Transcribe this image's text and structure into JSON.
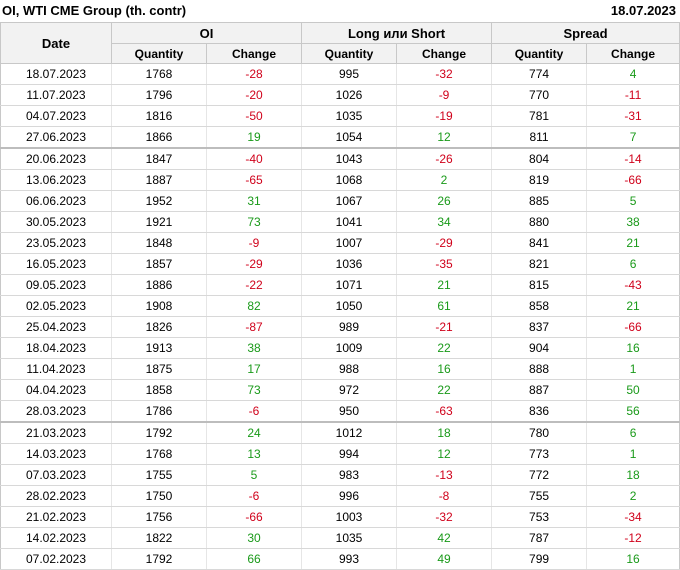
{
  "header": {
    "title": "OI, WTI CME Group (th. contr)",
    "date": "18.07.2023"
  },
  "table": {
    "date_header": "Date",
    "groups": [
      "OI",
      "Long или Short",
      "Spread"
    ],
    "sub_headers": [
      "Quantity",
      "Change",
      "Quantity",
      "Change",
      "Quantity",
      "Change"
    ],
    "rows": [
      [
        "18.07.2023",
        "1768",
        "-28",
        "995",
        "-32",
        "774",
        "4"
      ],
      [
        "11.07.2023",
        "1796",
        "-20",
        "1026",
        "-9",
        "770",
        "-11"
      ],
      [
        "04.07.2023",
        "1816",
        "-50",
        "1035",
        "-19",
        "781",
        "-31"
      ],
      [
        "27.06.2023",
        "1866",
        "19",
        "1054",
        "12",
        "811",
        "7"
      ],
      [
        "20.06.2023",
        "1847",
        "-40",
        "1043",
        "-26",
        "804",
        "-14"
      ],
      [
        "13.06.2023",
        "1887",
        "-65",
        "1068",
        "2",
        "819",
        "-66"
      ],
      [
        "06.06.2023",
        "1952",
        "31",
        "1067",
        "26",
        "885",
        "5"
      ],
      [
        "30.05.2023",
        "1921",
        "73",
        "1041",
        "34",
        "880",
        "38"
      ],
      [
        "23.05.2023",
        "1848",
        "-9",
        "1007",
        "-29",
        "841",
        "21"
      ],
      [
        "16.05.2023",
        "1857",
        "-29",
        "1036",
        "-35",
        "821",
        "6"
      ],
      [
        "09.05.2023",
        "1886",
        "-22",
        "1071",
        "21",
        "815",
        "-43"
      ],
      [
        "02.05.2023",
        "1908",
        "82",
        "1050",
        "61",
        "858",
        "21"
      ],
      [
        "25.04.2023",
        "1826",
        "-87",
        "989",
        "-21",
        "837",
        "-66"
      ],
      [
        "18.04.2023",
        "1913",
        "38",
        "1009",
        "22",
        "904",
        "16"
      ],
      [
        "11.04.2023",
        "1875",
        "17",
        "988",
        "16",
        "888",
        "1"
      ],
      [
        "04.04.2023",
        "1858",
        "73",
        "972",
        "22",
        "887",
        "50"
      ],
      [
        "28.03.2023",
        "1786",
        "-6",
        "950",
        "-63",
        "836",
        "56"
      ],
      [
        "21.03.2023",
        "1792",
        "24",
        "1012",
        "18",
        "780",
        "6"
      ],
      [
        "14.03.2023",
        "1768",
        "13",
        "994",
        "12",
        "773",
        "1"
      ],
      [
        "07.03.2023",
        "1755",
        "5",
        "983",
        "-13",
        "772",
        "18"
      ],
      [
        "28.02.2023",
        "1750",
        "-6",
        "996",
        "-8",
        "755",
        "2"
      ],
      [
        "21.02.2023",
        "1756",
        "-66",
        "1003",
        "-32",
        "753",
        "-34"
      ],
      [
        "14.02.2023",
        "1822",
        "30",
        "1035",
        "42",
        "787",
        "-12"
      ],
      [
        "07.02.2023",
        "1792",
        "66",
        "993",
        "49",
        "799",
        "16"
      ]
    ],
    "separator_after_rows": [
      3,
      16
    ]
  },
  "colors": {
    "negative": "#d0021b",
    "positive": "#1a9a1a",
    "header_bg": "#f2f2f2"
  }
}
